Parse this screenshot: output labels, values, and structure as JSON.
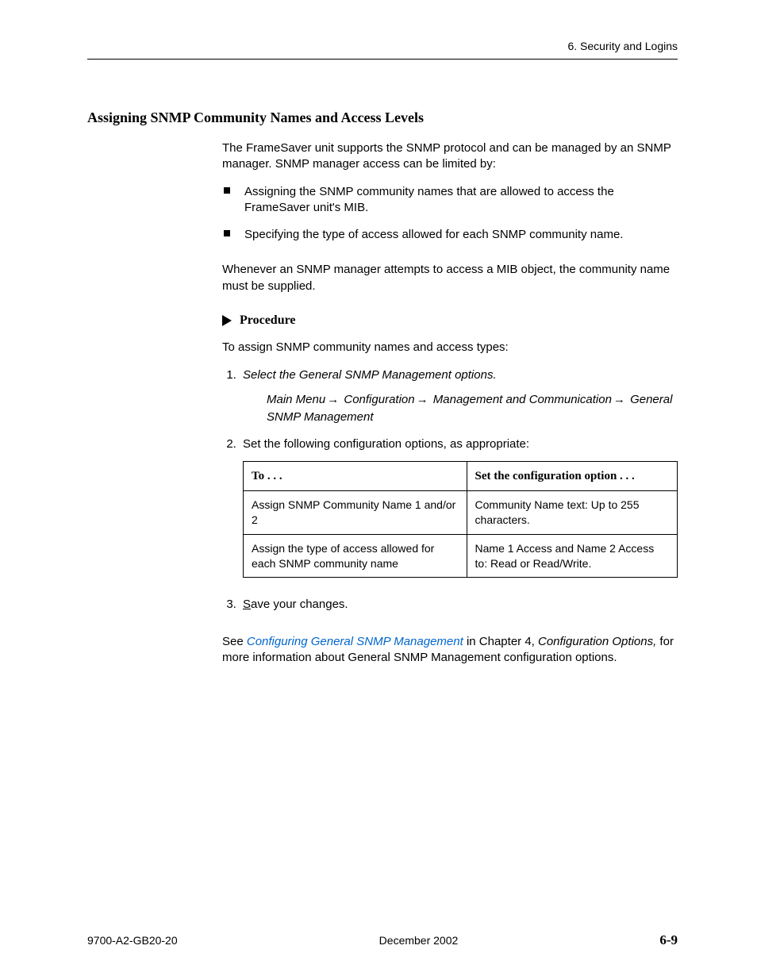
{
  "header": {
    "chapter": "6. Security and Logins"
  },
  "section": {
    "title": "Assigning SNMP Community Names and Access Levels",
    "intro": "The FrameSaver unit supports the SNMP protocol and can be managed by an SNMP manager. SNMP manager access can be limited by:",
    "bullets": [
      "Assigning the SNMP community names that are allowed to access the FrameSaver unit's MIB.",
      "Specifying the type of access allowed for each SNMP community name."
    ],
    "note": "Whenever an SNMP manager attempts to access a MIB object, the community name must be supplied."
  },
  "procedure": {
    "heading": "Procedure",
    "intro": "To assign SNMP community names and access types:",
    "step1_text": "Select the General SNMP Management options.",
    "menu_path": {
      "seg1": "Main Menu",
      "seg2": "Configuration",
      "seg3": "Management and Communication",
      "seg4": "General SNMP Management"
    },
    "step2_text": "Set the following configuration options, as appropriate:",
    "table": {
      "header_left": "To . . .",
      "header_right": "Set the configuration option . . .",
      "rows": [
        {
          "left": "Assign SNMP Community Name 1 and/or 2",
          "right": "Community Name text:  Up to 255 characters."
        },
        {
          "left": "Assign the type of access allowed for each SNMP community name",
          "right": "Name 1 Access and Name 2 Access to: Read or Read/Write."
        }
      ]
    },
    "step3_prefix": "S",
    "step3_rest": "ave your changes."
  },
  "footer_ref": {
    "pre": "See ",
    "link": "Configuring General SNMP Management",
    "mid": " in Chapter 4, ",
    "chapter_title": "Configuration Options,",
    "post": " for more information about General SNMP Management configuration options."
  },
  "footer": {
    "doc_number": "9700-A2-GB20-20",
    "date": "December 2002",
    "page": "6-9"
  }
}
